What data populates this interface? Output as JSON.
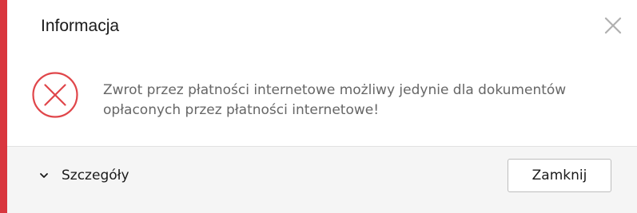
{
  "dialog": {
    "title": "Informacja",
    "message": "Zwrot przez płatności internetowe możliwy jedynie dla dokumentów opłaconych przez płatności internetowe!",
    "icons": {
      "close": "close-icon",
      "status": "error-circle-icon",
      "toggle": "chevron-down-icon"
    },
    "details_label": "Szczegóły",
    "close_button_label": "Zamknij"
  },
  "colors": {
    "accent": "#d9363e",
    "error_icon": "#e0464a"
  }
}
